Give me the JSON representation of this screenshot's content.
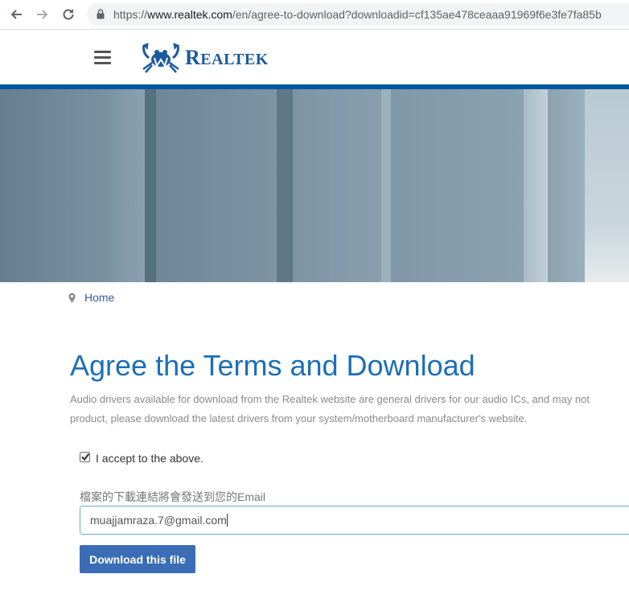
{
  "browser": {
    "url_scheme": "https://",
    "url_host": "www.realtek.com",
    "url_path": "/en/agree-to-download?downloadid=cf135ae478ceaaa91969f6e3fe7fa85b"
  },
  "header": {
    "logo_first": "R",
    "logo_rest": "EALTEK",
    "brand_color": "#00599e"
  },
  "breadcrumb": {
    "home": "Home"
  },
  "page": {
    "title": "Agree the Terms and Download",
    "description_line1": "Audio drivers available for download from the Realtek website are general drivers for our audio ICs, and may not",
    "description_line2": "product, please download the latest drivers from your system/motherboard manufacturer's website."
  },
  "form": {
    "accept_checked": true,
    "accept_label": "I accept to the above.",
    "email_label": "檔案的下載連結將會發送到您的Email",
    "email_value": "muajjamraza.7@gmail.com",
    "download_label": "Download this file",
    "button_color": "#3a6db5"
  }
}
